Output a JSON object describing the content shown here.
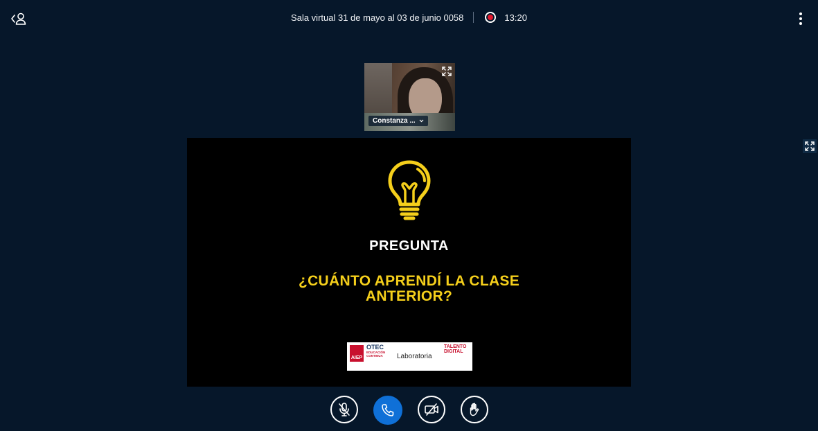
{
  "header": {
    "meeting_title": "Sala virtual 31 de mayo al 03 de junio 0058",
    "elapsed_time": "13:20",
    "icons": {
      "users_toggle": "chevron-left-user-icon",
      "recording": "recording-icon",
      "options": "vertical-dots-icon"
    }
  },
  "webcam": {
    "participant_name": "Constanza ...",
    "icons": {
      "expand": "fullscreen-icon",
      "name_menu": "chevron-down-icon"
    }
  },
  "presentation": {
    "slide_heading": "PREGUNTA",
    "slide_question_line1": "¿CUÁNTO APRENDÍ LA CLASE",
    "slide_question_line2": "ANTERIOR?",
    "logos": {
      "aiep": "AIEP",
      "otec": "OTEC",
      "otec_sub1": "EDUCACIÓN",
      "otec_sub2": "CONTINUA",
      "laboratoria": "Laboratoria",
      "talento1": "TALENTO",
      "talento2": "DIGITAL"
    },
    "icons": {
      "bulb": "lightbulb-icon",
      "expand": "fullscreen-icon"
    }
  },
  "controls": {
    "icons": {
      "mic": "microphone-muted-icon",
      "phone": "phone-icon",
      "camera": "camera-off-icon",
      "hand": "raise-hand-icon"
    }
  },
  "colors": {
    "background": "#06172a",
    "primary": "#0f70d7",
    "recording": "#e3182d",
    "slide_accent": "#f5cf1b"
  }
}
